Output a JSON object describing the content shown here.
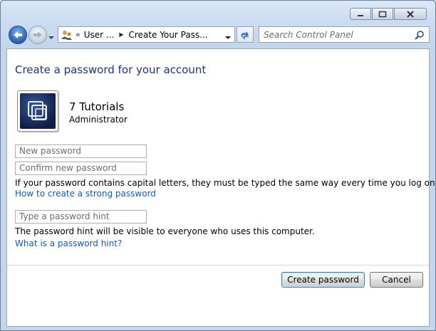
{
  "window": {
    "caption_buttons": [
      "minimize",
      "maximize",
      "close"
    ]
  },
  "address_bar": {
    "overflow_chevron": "«",
    "crumbs": [
      "User ...",
      "Create Your Pass..."
    ]
  },
  "search": {
    "placeholder": "Search Control Panel"
  },
  "page": {
    "title": "Create a password for your account"
  },
  "user": {
    "name": "7 Tutorials",
    "role": "Administrator"
  },
  "form": {
    "new_password_placeholder": "New password",
    "confirm_password_placeholder": "Confirm new password",
    "capital_letters_note": "If your password contains capital letters, they must be typed the same way every time you log on.",
    "strong_password_link": "How to create a strong password",
    "hint_placeholder": "Type a password hint",
    "hint_note": "The password hint will be visible to everyone who uses this computer.",
    "hint_link": "What is a password hint?"
  },
  "buttons": {
    "create_label": "Create password",
    "cancel_label": "Cancel"
  },
  "colors": {
    "title_blue": "#1e3287",
    "link_blue": "#0b5ac9"
  }
}
